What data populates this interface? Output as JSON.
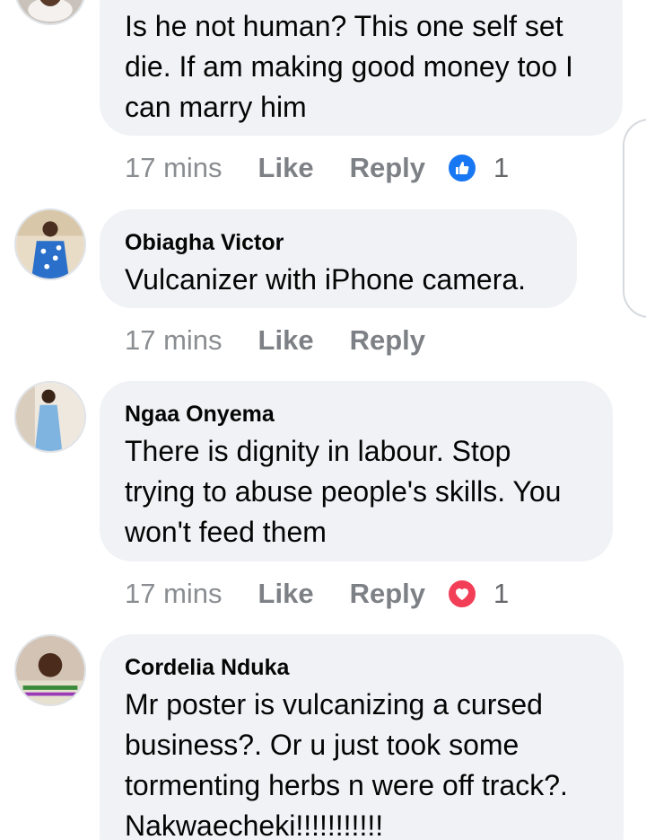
{
  "colors": {
    "bubble_bg": "#f0f2f5",
    "meta_text": "#65676b",
    "like_reaction": "#1877f2",
    "love_reaction": "#f33e58"
  },
  "comments": [
    {
      "author": "",
      "text": "Is he not human? This one self set die. If am making good money too I can marry him",
      "time": "17 mins",
      "like_label": "Like",
      "reply_label": "Reply",
      "reaction_icon": "like-reaction-icon",
      "reaction_count": "1"
    },
    {
      "author": "Obiagha Victor",
      "text": "Vulcanizer with iPhone camera.",
      "time": "17 mins",
      "like_label": "Like",
      "reply_label": "Reply",
      "reaction_icon": "",
      "reaction_count": ""
    },
    {
      "author": "Ngaa Onyema",
      "text": "There is dignity in labour. Stop trying to abuse people's skills. You won't feed them",
      "time": "17 mins",
      "like_label": "Like",
      "reply_label": "Reply",
      "reaction_icon": "love-reaction-icon",
      "reaction_count": "1"
    },
    {
      "author": "Cordelia Nduka",
      "text": "Mr poster is vulcanizing a cursed business?. Or u just took some tormenting herbs n were off track?. Nakwaecheki!!!!!!!!!!!",
      "time": "",
      "like_label": "",
      "reply_label": "",
      "reaction_icon": "",
      "reaction_count": ""
    }
  ]
}
